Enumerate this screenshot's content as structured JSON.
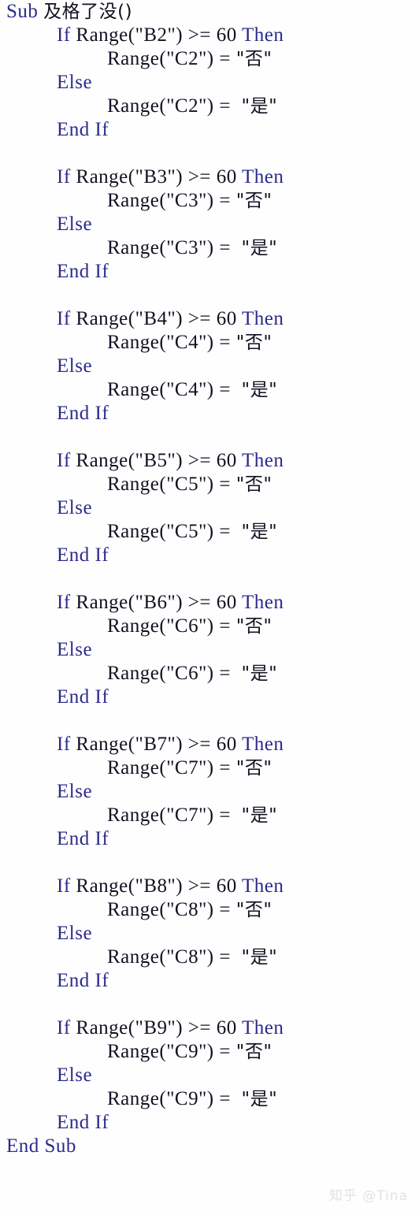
{
  "document": {
    "kind": "vba-code-listing",
    "background_color": "#fefefe",
    "keyword_color": "#2a2a8c",
    "plain_color": "#111122",
    "watermark_color": "#e2e2e2"
  },
  "tokens": {
    "sub": "Sub",
    "end": "End",
    "if": "If",
    "then": "Then",
    "else": "Else",
    "end_if": "End If",
    "end_sub": "End Sub",
    "procedure_name": "及格了没()",
    "operator": ">=",
    "threshold": "60",
    "assign": "=",
    "value_fail": "\"否\"",
    "value_pass": "\"是\"",
    "range_fn": "Range"
  },
  "code": {
    "header": {
      "keyword": "Sub",
      "name": "及格了没()"
    },
    "footer": {
      "keyword": "End Sub"
    },
    "blocks": [
      {
        "condition_cell": "\"B2\"",
        "target_cell": "\"C2\"",
        "if_text": "If Range(\"B2\") >= 60 Then",
        "then_text": "Range(\"C2\") = \"否\"",
        "else_text": "Else",
        "else_body_text": "Range(\"C2\") = \"是\"",
        "end_text": "End If"
      },
      {
        "condition_cell": "\"B3\"",
        "target_cell": "\"C3\"",
        "if_text": "If Range(\"B3\") >= 60 Then",
        "then_text": "Range(\"C3\") = \"否\"",
        "else_text": "Else",
        "else_body_text": "Range(\"C3\") = \"是\"",
        "end_text": "End If"
      },
      {
        "condition_cell": "\"B4\"",
        "target_cell": "\"C4\"",
        "if_text": "If Range(\"B4\") >= 60 Then",
        "then_text": "Range(\"C4\") = \"否\"",
        "else_text": "Else",
        "else_body_text": "Range(\"C4\") = \"是\"",
        "end_text": "End If"
      },
      {
        "condition_cell": "\"B5\"",
        "target_cell": "\"C5\"",
        "if_text": "If Range(\"B5\") >= 60 Then",
        "then_text": "Range(\"C5\") = \"否\"",
        "else_text": "Else",
        "else_body_text": "Range(\"C5\") = \"是\"",
        "end_text": "End If"
      },
      {
        "condition_cell": "\"B6\"",
        "target_cell": "\"C6\"",
        "if_text": "If Range(\"B6\") >= 60 Then",
        "then_text": "Range(\"C6\") = \"否\"",
        "else_text": "Else",
        "else_body_text": "Range(\"C6\") = \"是\"",
        "end_text": "End If"
      },
      {
        "condition_cell": "\"B7\"",
        "target_cell": "\"C7\"",
        "if_text": "If Range(\"B7\") >= 60 Then",
        "then_text": "Range(\"C7\") = \"否\"",
        "else_text": "Else",
        "else_body_text": "Range(\"C7\") = \"是\"",
        "end_text": "End If"
      },
      {
        "condition_cell": "\"B8\"",
        "target_cell": "\"C8\"",
        "if_text": "If Range(\"B8\") >= 60 Then",
        "then_text": "Range(\"C8\") = \"否\"",
        "else_text": "Else",
        "else_body_text": "Range(\"C8\") = \"是\"",
        "end_text": "End If"
      },
      {
        "condition_cell": "\"B9\"",
        "target_cell": "\"C9\"",
        "if_text": "If Range(\"B9\") >= 60 Then",
        "then_text": "Range(\"C9\") = \"否\"",
        "else_text": "Else",
        "else_body_text": "Range(\"C9\") = \"是\"",
        "end_text": "End If"
      }
    ]
  },
  "watermark": {
    "text": "知乎 @Tina"
  }
}
